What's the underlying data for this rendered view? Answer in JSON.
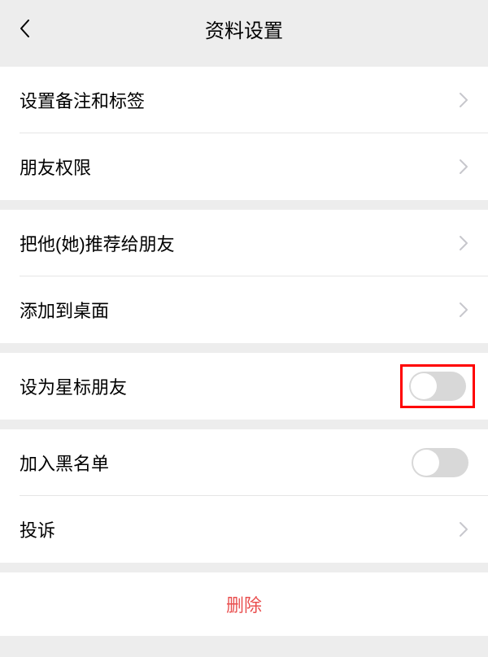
{
  "header": {
    "title": "资料设置"
  },
  "sections": {
    "s1": {
      "remarks": "设置备注和标签",
      "permissions": "朋友权限"
    },
    "s2": {
      "recommend": "把他(她)推荐给朋友",
      "desktop": "添加到桌面"
    },
    "s3": {
      "star": "设为星标朋友"
    },
    "s4": {
      "blacklist": "加入黑名单",
      "report": "投诉"
    }
  },
  "delete": {
    "label": "删除"
  }
}
